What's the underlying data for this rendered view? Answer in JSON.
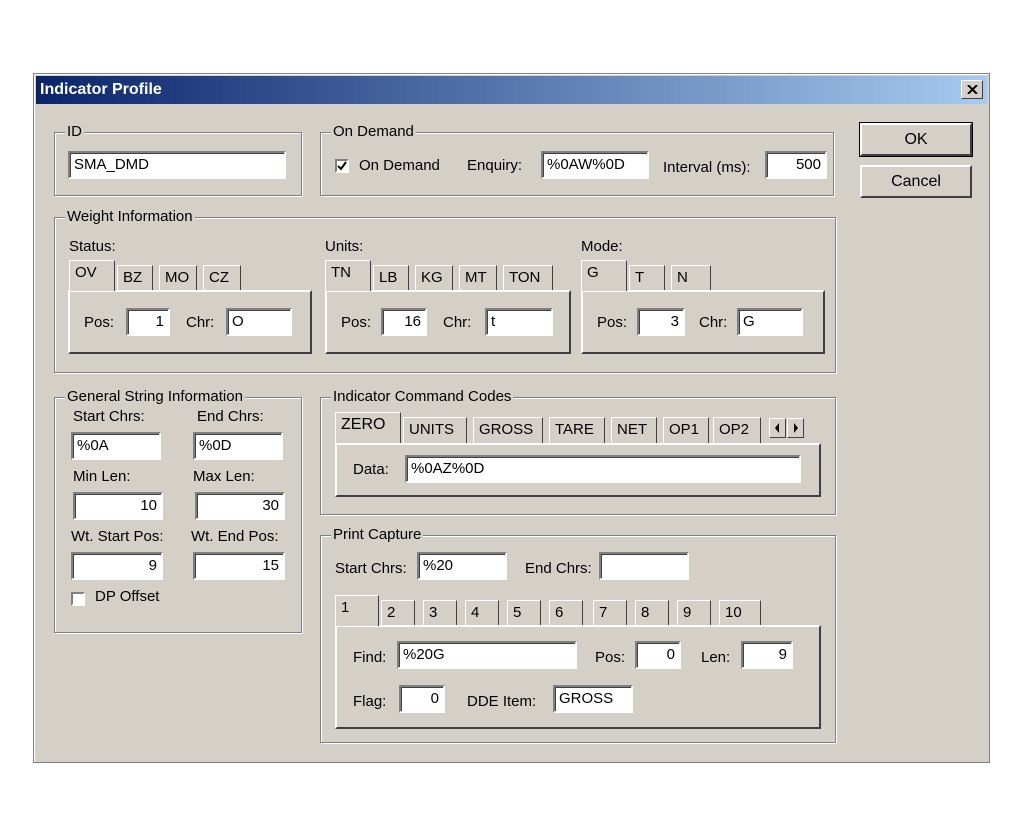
{
  "window": {
    "title": "Indicator Profile"
  },
  "buttons": {
    "ok": "OK",
    "cancel": "Cancel"
  },
  "id_group": {
    "label": "ID",
    "value": "SMA_DMD"
  },
  "on_demand": {
    "label": "On Demand",
    "checkbox_label": "On Demand",
    "checked": true,
    "enquiry_label": "Enquiry:",
    "enquiry_value": "%0AW%0D",
    "interval_label": "Interval (ms):",
    "interval_value": "500"
  },
  "weight": {
    "label": "Weight Information",
    "status": {
      "label": "Status:",
      "tabs": [
        "OV",
        "BZ",
        "MO",
        "CZ"
      ],
      "pos_label": "Pos:",
      "pos": "1",
      "chr_label": "Chr:",
      "chr": "O"
    },
    "units": {
      "label": "Units:",
      "tabs": [
        "TN",
        "LB",
        "KG",
        "MT",
        "TON"
      ],
      "pos_label": "Pos:",
      "pos": "16",
      "chr_label": "Chr:",
      "chr": "t"
    },
    "mode": {
      "label": "Mode:",
      "tabs": [
        "G",
        "T",
        "N"
      ],
      "pos_label": "Pos:",
      "pos": "3",
      "chr_label": "Chr:",
      "chr": "G"
    }
  },
  "general": {
    "label": "General String Information",
    "start_label": "Start Chrs:",
    "start": "%0A",
    "end_label": "End Chrs:",
    "end": "%0D",
    "min_label": "Min Len:",
    "min": "10",
    "max_label": "Max Len:",
    "max": "30",
    "wstart_label": "Wt. Start Pos:",
    "wstart": "9",
    "wend_label": "Wt. End Pos:",
    "wend": "15",
    "dp_label": "DP Offset"
  },
  "commands": {
    "label": "Indicator Command Codes",
    "tabs": [
      "ZERO",
      "UNITS",
      "GROSS",
      "TARE",
      "NET",
      "OP1",
      "OP2"
    ],
    "data_label": "Data:",
    "data": "%0AZ%0D"
  },
  "print": {
    "label": "Print Capture",
    "start_label": "Start Chrs:",
    "start": "%20",
    "end_label": "End Chrs:",
    "end": "",
    "tabs": [
      "1",
      "2",
      "3",
      "4",
      "5",
      "6",
      "7",
      "8",
      "9",
      "10"
    ],
    "find_label": "Find:",
    "find": "%20G",
    "pos_label": "Pos:",
    "pos": "0",
    "len_label": "Len:",
    "len": "9",
    "flag_label": "Flag:",
    "flag": "0",
    "dde_label": "DDE Item:",
    "dde": "GROSS"
  }
}
